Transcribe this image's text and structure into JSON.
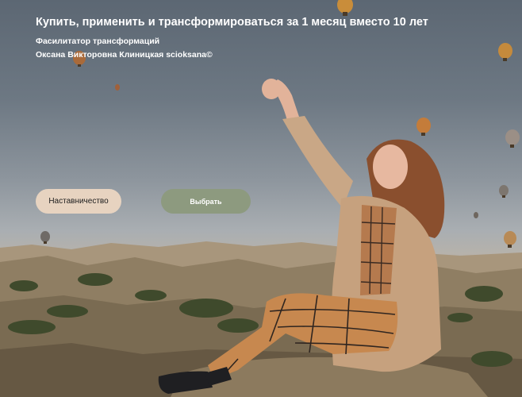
{
  "hero": {
    "title": "Купить, применить и трансформироваться за 1 месяц вместо 10 лет",
    "subtitle_line1": "Фасилитатор трансформаций",
    "subtitle_line2": "Оксана Викторовна Клиницкая scioksana©"
  },
  "buttons": {
    "mentorship_label": "Наставничество",
    "select_label": "Выбрать"
  },
  "colors": {
    "mentorship_button_bg": "#e7d3c0",
    "select_button_bg": "#8d9a7f",
    "title_text": "#ffffff"
  }
}
